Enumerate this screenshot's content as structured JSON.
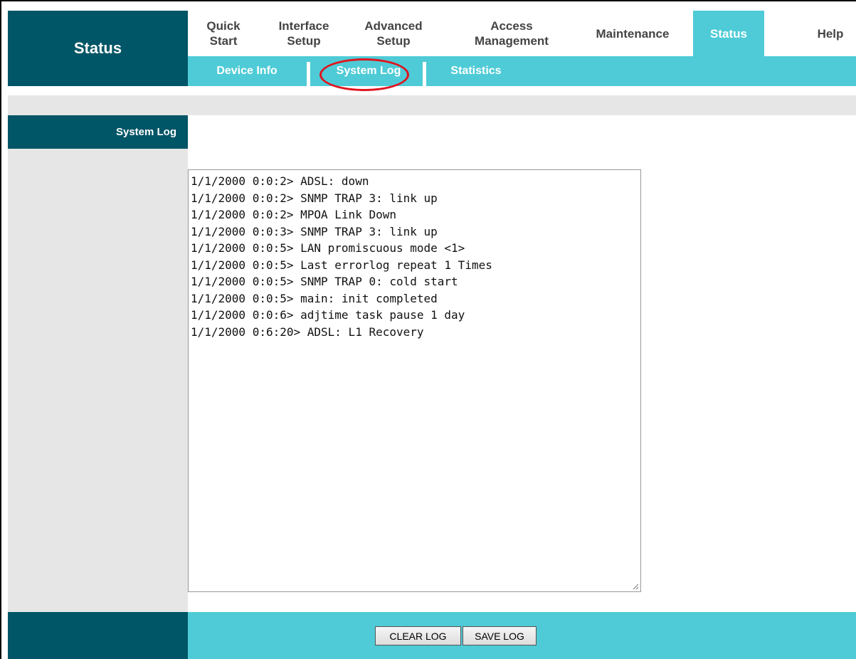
{
  "brand": {
    "title": "Status"
  },
  "top_menu": [
    {
      "line1": "Quick",
      "line2": "Start"
    },
    {
      "line1": "Interface",
      "line2": "Setup"
    },
    {
      "line1": "Advanced",
      "line2": "Setup"
    },
    {
      "line1": "Access",
      "line2": "Management"
    },
    {
      "line1": "Maintenance",
      "line2": ""
    },
    {
      "line1": "Status",
      "line2": "",
      "active": true
    },
    {
      "line1": "Help",
      "line2": ""
    }
  ],
  "sub_menu": [
    {
      "label": "Device Info"
    },
    {
      "label": "System Log",
      "active": true
    },
    {
      "label": "Statistics"
    }
  ],
  "section": {
    "title": "System Log"
  },
  "log_lines": [
    "1/1/2000 0:0:2> ADSL: down",
    "1/1/2000 0:0:2> SNMP TRAP 3: link up",
    "1/1/2000 0:0:2> MPOA Link Down",
    "1/1/2000 0:0:3> SNMP TRAP 3: link up",
    "1/1/2000 0:0:5> LAN promiscuous mode <1>",
    "1/1/2000 0:0:5> Last errorlog repeat 1 Times",
    "1/1/2000 0:0:5> SNMP TRAP 0: cold start",
    "1/1/2000 0:0:5> main: init completed",
    "1/1/2000 0:0:6> adjtime task pause 1 day",
    "1/1/2000 0:6:20> ADSL: L1 Recovery"
  ],
  "buttons": {
    "clear_log": "CLEAR LOG",
    "save_log": "SAVE LOG"
  },
  "colors": {
    "dark_teal": "#005566",
    "light_teal": "#4ecbd6",
    "panel_gray": "#e6e6e6",
    "highlight_red": "#e0141e"
  }
}
